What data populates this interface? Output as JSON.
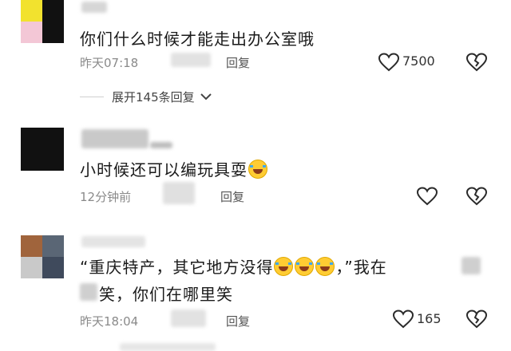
{
  "comments": [
    {
      "text": "你们什么时候才能走出办公室哦",
      "time": "昨天07:18",
      "reply_label": "回复",
      "like_count": "7500",
      "expand_label": "展开145条回复"
    },
    {
      "text": "小时候还可以编玩具耍",
      "time": "12分钟前",
      "reply_label": "回复"
    },
    {
      "text_line1_a": "“重庆特产，其它地方没得",
      "text_line1_b": "，”我在",
      "text_line2": "笑，你们在哪里笑",
      "time": "昨天18:04",
      "reply_label": "回复",
      "like_count": "165"
    }
  ],
  "colors": {
    "avatar1": [
      "#f2e22e",
      "#111111",
      "#f3c7d6",
      "#111111"
    ],
    "avatar2": [
      "#111111",
      "#111111",
      "#111111",
      "#111111"
    ],
    "avatar3": [
      "#a0643c",
      "#5a6675",
      "#c9c9c9",
      "#3f4a5c"
    ],
    "emoji": "#ffcc33"
  },
  "icons": [
    "heart-icon",
    "broken-heart-icon",
    "chevron-down-icon",
    "laughing-crying-emoji"
  ]
}
